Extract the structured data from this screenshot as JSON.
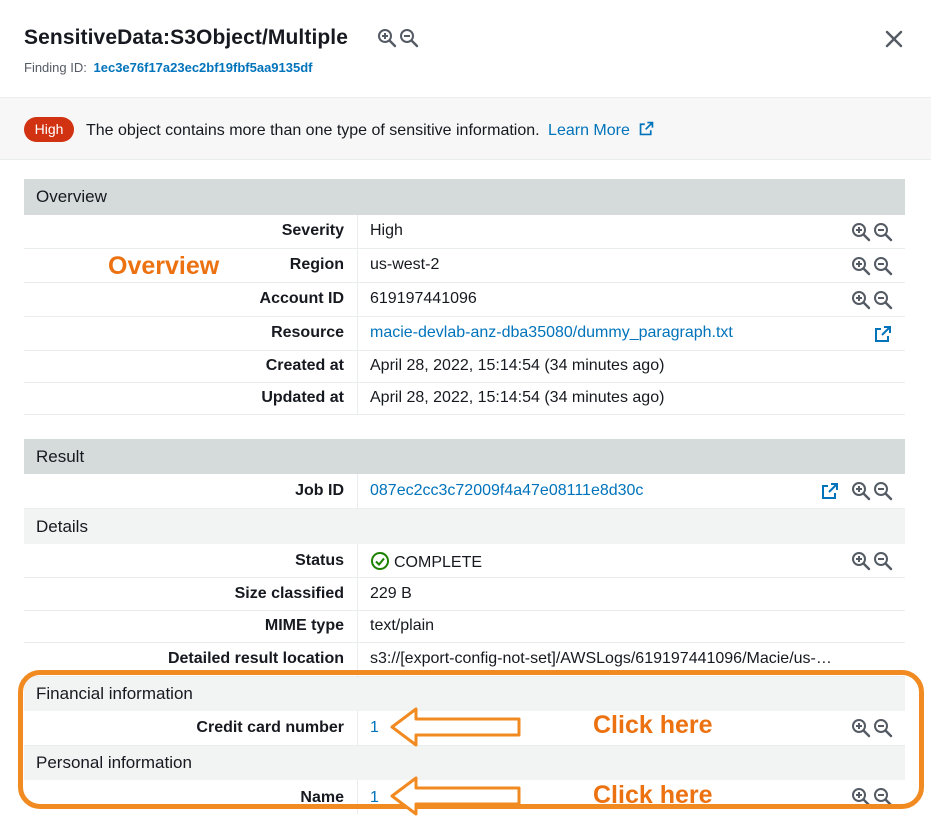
{
  "header": {
    "title": "SensitiveData:S3Object/Multiple",
    "finding_label": "Finding ID:",
    "finding_id": "1ec3e76f17a23ec2bf19fbf5aa9135df"
  },
  "banner": {
    "badge": "High",
    "text": "The object contains more than one type of sensitive information.",
    "learn_more": "Learn More"
  },
  "overview": {
    "heading": "Overview",
    "annotation": "Overview",
    "rows": [
      {
        "key": "Severity",
        "value": "High"
      },
      {
        "key": "Region",
        "value": "us-west-2"
      },
      {
        "key": "Account ID",
        "value": "619197441096"
      },
      {
        "key": "Resource",
        "value": "macie-devlab-anz-dba35080/dummy_paragraph.txt"
      },
      {
        "key": "Created at",
        "value": "April 28, 2022, 15:14:54 (34 minutes ago)"
      },
      {
        "key": "Updated at",
        "value": "April 28, 2022, 15:14:54 (34 minutes ago)"
      }
    ]
  },
  "result": {
    "heading": "Result",
    "job_id_key": "Job ID",
    "job_id": "087ec2cc3c72009f4a47e08111e8d30c",
    "details_heading": "Details",
    "rows": [
      {
        "key": "Status",
        "value": "COMPLETE"
      },
      {
        "key": "Size classified",
        "value": "229 B"
      },
      {
        "key": "MIME type",
        "value": "text/plain"
      },
      {
        "key": "Detailed result location",
        "value": "s3://[export-config-not-set]/AWSLogs/619197441096/Macie/us-…"
      }
    ]
  },
  "financial": {
    "heading": "Financial information",
    "key": "Credit card number",
    "value": "1",
    "annotation": "Click here"
  },
  "personal": {
    "heading": "Personal information",
    "key": "Name",
    "value": "1",
    "annotation": "Click here"
  },
  "colors": {
    "accent_orange": "#ec7211",
    "link_blue": "#0073bb",
    "high_red": "#d13212",
    "success_green": "#1d8102",
    "section_gray": "#d5dbdb"
  },
  "icons": [
    "zoom-in-icon",
    "zoom-out-icon",
    "close-icon",
    "external-link-icon",
    "check-circle-icon",
    "arrow-left-icon"
  ]
}
